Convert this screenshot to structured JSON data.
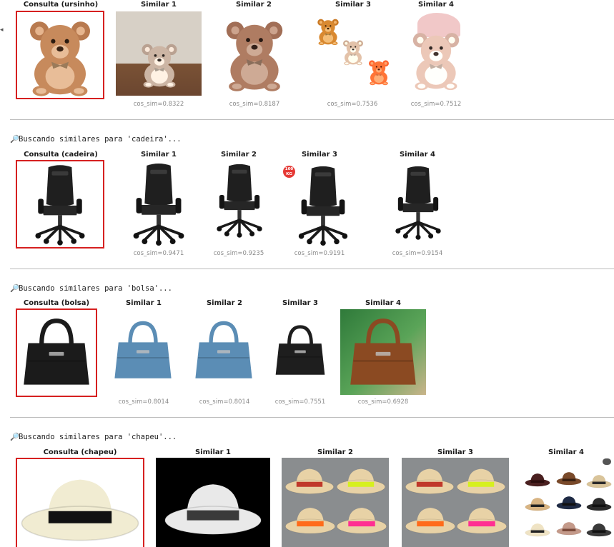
{
  "rows": [
    {
      "header": "",
      "panels": [
        {
          "title": "Consulta (ursinho)",
          "score": "",
          "icon": "teddy-bear-icon"
        },
        {
          "title": "Similar 1",
          "score": "cos_sim=0.8322",
          "icon": "teddy-bear-icon"
        },
        {
          "title": "Similar 2",
          "score": "cos_sim=0.8187",
          "icon": "teddy-bear-icon"
        },
        {
          "title": "Similar 3",
          "score": "cos_sim=0.7536",
          "icon": "teddy-bear-icon"
        },
        {
          "title": "Similar 4",
          "score": "cos_sim=0.7512",
          "icon": "teddy-bear-icon"
        }
      ]
    },
    {
      "header": "Buscando similares para 'cadeira'...",
      "panels": [
        {
          "title": "Consulta (cadeira)",
          "score": "",
          "icon": "gaming-chair-icon"
        },
        {
          "title": "Similar 1",
          "score": "cos_sim=0.9471",
          "icon": "gaming-chair-icon"
        },
        {
          "title": "Similar 2",
          "score": "cos_sim=0.9235",
          "icon": "gaming-chair-icon"
        },
        {
          "title": "Similar 3",
          "score": "cos_sim=0.9191",
          "icon": "gaming-chair-icon"
        },
        {
          "title": "Similar 4",
          "score": "cos_sim=0.9154",
          "icon": "gaming-chair-icon"
        }
      ]
    },
    {
      "header": "Buscando similares para 'bolsa'...",
      "panels": [
        {
          "title": "Consulta (bolsa)",
          "score": "",
          "icon": "handbag-icon"
        },
        {
          "title": "Similar 1",
          "score": "cos_sim=0.8014",
          "icon": "handbag-icon"
        },
        {
          "title": "Similar 2",
          "score": "cos_sim=0.8014",
          "icon": "handbag-icon"
        },
        {
          "title": "Similar 3",
          "score": "cos_sim=0.7551",
          "icon": "handbag-icon"
        },
        {
          "title": "Similar 4",
          "score": "cos_sim=0.6928",
          "icon": "handbag-icon"
        }
      ]
    },
    {
      "header": "Buscando similares para 'chapeu'...",
      "panels": [
        {
          "title": "Consulta (chapeu)",
          "score": "",
          "icon": "hat-icon"
        },
        {
          "title": "Similar 1",
          "score": "",
          "icon": "hat-icon"
        },
        {
          "title": "Similar 2",
          "score": "",
          "icon": "hat-icon"
        },
        {
          "title": "Similar 3",
          "score": "",
          "icon": "hat-icon"
        },
        {
          "title": "Similar 4",
          "score": "",
          "icon": "hat-icon"
        }
      ]
    }
  ],
  "badge_text": "100 KG",
  "colors": {
    "query_border": "#d62020",
    "divider": "#bdbdbd",
    "score_text": "#8a8a8a"
  }
}
